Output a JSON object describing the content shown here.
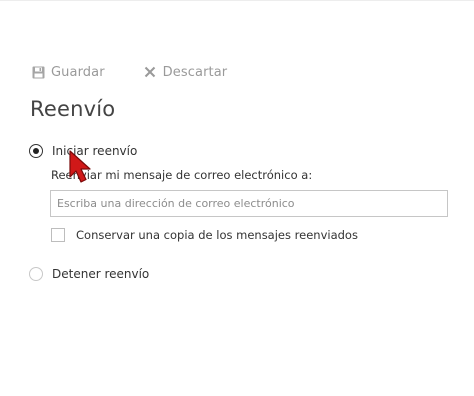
{
  "toolbar": {
    "save_label": "Guardar",
    "discard_label": "Descartar",
    "save_icon": "save-disk-icon",
    "discard_icon": "x-icon"
  },
  "heading": "Reenvío",
  "forwarding": {
    "start_label": "Iniciar reenvío",
    "start_selected": true,
    "forward_to_label": "Reenviar mi mensaje de correo electrónico a:",
    "email_placeholder": "Escriba una dirección de correo electrónico",
    "email_value": "",
    "keep_copy_label": "Conservar una copia de los mensajes reenviados",
    "keep_copy_checked": false,
    "stop_label": "Detener reenvío",
    "stop_selected": false
  },
  "colors": {
    "disabled_text": "#9a9a9a",
    "cursor_red": "#d01818"
  }
}
